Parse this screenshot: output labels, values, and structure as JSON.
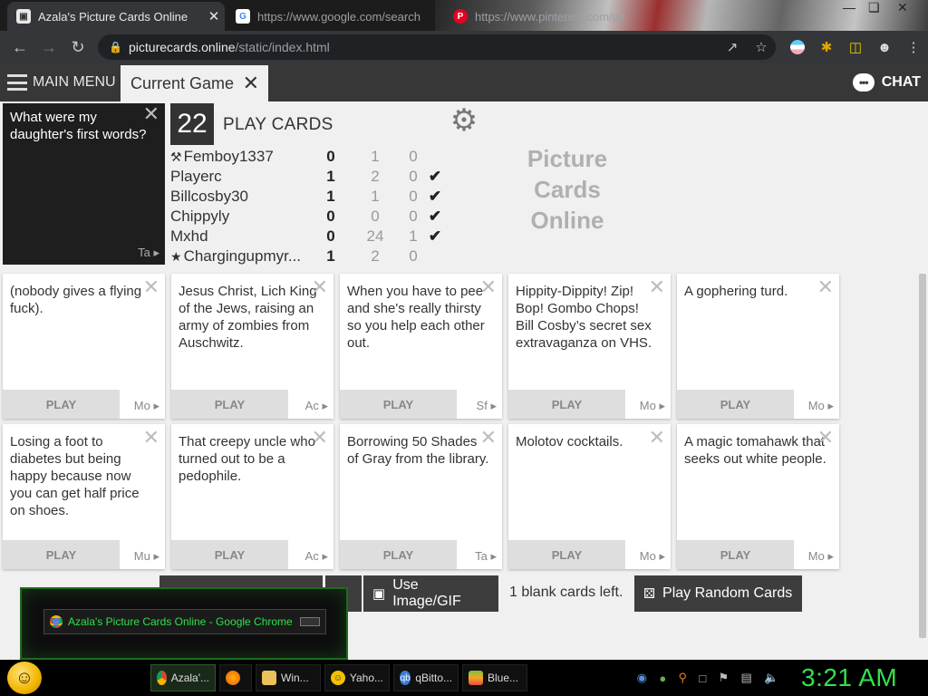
{
  "browser": {
    "tabs": [
      {
        "title": "Azala's Picture Cards Online",
        "favicon": "cards-favicon",
        "active": true
      },
      {
        "title": "https://www.google.com/search",
        "favicon": "google-favicon",
        "active": false
      },
      {
        "title": "https://www.pinterest.com/pin",
        "favicon": "pinterest-favicon",
        "active": false
      }
    ],
    "url_domain": "picturecards.online",
    "url_path": "/static/index.html"
  },
  "app": {
    "main_menu_label": "MAIN MENU",
    "current_tab_label": "Current Game",
    "chat_label": "CHAT",
    "prompt": {
      "text": "What were my daughter's first words?",
      "pack": "Ta"
    },
    "counter": "22",
    "play_cards_label": "PLAY CARDS",
    "logo_lines": [
      "Picture",
      "Cards",
      "Online"
    ],
    "players": [
      {
        "icon": "gavel-icon",
        "name": "Femboy1337",
        "score": "0",
        "col2": "1",
        "col3": "0",
        "check": false
      },
      {
        "icon": "",
        "name": "Playerc",
        "score": "1",
        "col2": "2",
        "col3": "0",
        "check": true
      },
      {
        "icon": "",
        "name": "Billcosby30",
        "score": "1",
        "col2": "1",
        "col3": "0",
        "check": true
      },
      {
        "icon": "",
        "name": "Chippyly",
        "score": "0",
        "col2": "0",
        "col3": "0",
        "check": true
      },
      {
        "icon": "",
        "name": "Mxhd",
        "score": "0",
        "col2": "24",
        "col3": "1",
        "check": true
      },
      {
        "icon": "star-icon",
        "name": "Chargingupmyr...",
        "score": "1",
        "col2": "2",
        "col3": "0",
        "check": false
      }
    ],
    "cards": [
      {
        "text": "(nobody gives a flying fuck).",
        "pack": "Mo"
      },
      {
        "text": "Jesus Christ, Lich King of the Jews, raising an army of zombies from Auschwitz.",
        "pack": "Ac"
      },
      {
        "text": "When you have to pee and she's really thirsty so you help each other out.",
        "pack": "Sf"
      },
      {
        "text": "Hippity-Dippity! Zip! Bop! Gombo Chops! Bill Cosby’s secret sex extravaganza on VHS.",
        "pack": "Mo"
      },
      {
        "text": "A gophering turd.",
        "pack": "Mo"
      },
      {
        "text": "Losing a foot to diabetes but being happy because now you can get half price on shoes.",
        "pack": "Mu"
      },
      {
        "text": "That creepy uncle who turned out to be a pedophile.",
        "pack": "Ac"
      },
      {
        "text": "Borrowing 50 Shades of Gray from the library.",
        "pack": "Ta"
      },
      {
        "text": "Molotov cocktails.",
        "pack": "Mo"
      },
      {
        "text": "A magic tomahawk that seeks out white people.",
        "pack": "Mo"
      }
    ],
    "play_label": "PLAY",
    "use_image_label": "Use Image/GIF",
    "blank_cards_left": "1 blank cards left.",
    "random_cards_label": "Play Random Cards"
  },
  "thumbnail_preview": {
    "title": "Azala's Picture Cards Online - Google Chrome"
  },
  "taskbar": {
    "items": [
      {
        "label": "Azala'...",
        "icon": "chrome-icon",
        "active": true
      },
      {
        "label": "",
        "icon": "firefox-icon",
        "active": false
      },
      {
        "label": "Win...",
        "icon": "folder-icon",
        "active": false
      },
      {
        "label": "Yaho...",
        "icon": "yahoo-icon",
        "active": false
      },
      {
        "label": "qBitto...",
        "icon": "qbittorrent-icon",
        "active": false
      },
      {
        "label": "Blue...",
        "icon": "bluestacks-icon",
        "active": false
      }
    ],
    "clock": "3:21 AM"
  },
  "colors": {
    "app_header": "#373737",
    "dark_button": "#3d3d3d",
    "clock_green": "#33e14a"
  }
}
